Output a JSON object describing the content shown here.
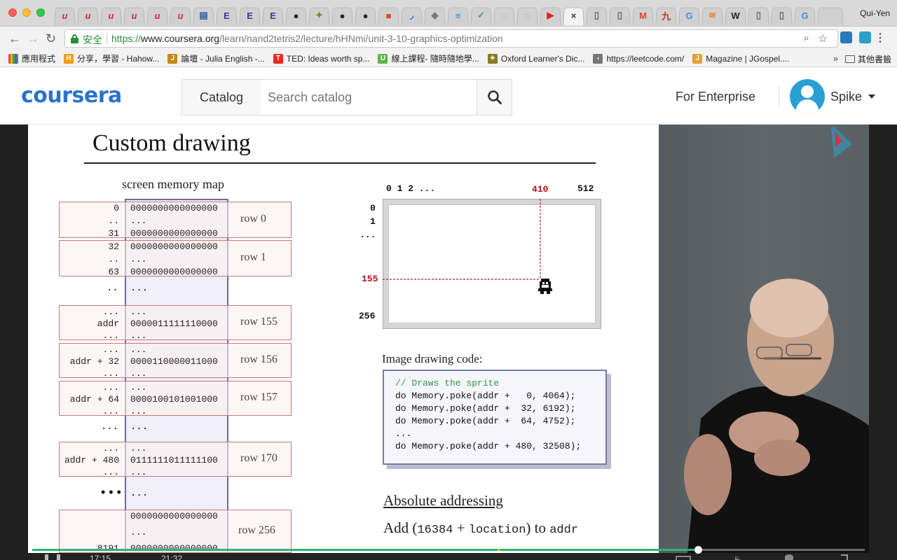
{
  "browser": {
    "profile_name": "Qui-Yen",
    "tabs": [
      {
        "glyph": "u",
        "color": "#d9262f"
      },
      {
        "glyph": "u",
        "color": "#d9262f"
      },
      {
        "glyph": "u",
        "color": "#d9262f"
      },
      {
        "glyph": "u",
        "color": "#d9262f"
      },
      {
        "glyph": "u",
        "color": "#d9262f"
      },
      {
        "glyph": "u",
        "color": "#d9262f"
      },
      {
        "glyph": "▤",
        "color": "#2a5aa8"
      },
      {
        "glyph": "E",
        "color": "#3a3a9a"
      },
      {
        "glyph": "E",
        "color": "#3a3a9a"
      },
      {
        "glyph": "E",
        "color": "#3a3a9a"
      },
      {
        "glyph": "●",
        "color": "#222222"
      },
      {
        "glyph": "✦",
        "color": "#8a7a20"
      },
      {
        "glyph": "●",
        "color": "#222222"
      },
      {
        "glyph": "●",
        "color": "#222222"
      },
      {
        "glyph": "■",
        "color": "#e2462f"
      },
      {
        "glyph": "◞",
        "color": "#2a6fd6"
      },
      {
        "glyph": "◆",
        "color": "#777777"
      },
      {
        "glyph": "≡",
        "color": "#1e88e5"
      },
      {
        "glyph": "✓",
        "color": "#3aa64a"
      },
      {
        "glyph": "◌",
        "color": "#aaaaaa"
      },
      {
        "glyph": "◌",
        "color": "#e67e22"
      },
      {
        "glyph": "▶",
        "color": "#e62117"
      },
      {
        "glyph": "×",
        "color": "#333333",
        "active": true
      },
      {
        "glyph": "▯",
        "color": "#666666"
      },
      {
        "glyph": "▯",
        "color": "#666666"
      },
      {
        "glyph": "M",
        "color": "#d44638"
      },
      {
        "glyph": "九",
        "color": "#c0392b"
      },
      {
        "glyph": "G",
        "color": "#4285f4"
      },
      {
        "glyph": "≋",
        "color": "#f48024"
      },
      {
        "glyph": "W",
        "color": "#222222"
      },
      {
        "glyph": "▯",
        "color": "#666666"
      },
      {
        "glyph": "▯",
        "color": "#666666"
      },
      {
        "glyph": "G",
        "color": "#4285f4"
      }
    ],
    "nav": {
      "back": "←",
      "forward": "→",
      "reload": "↻"
    },
    "secure_label": "安全",
    "url": {
      "scheme": "https://",
      "host": "www.coursera.org",
      "path": "/learn/nand2tetris2/lecture/hHNmi/unit-3-10-graphics-optimization"
    },
    "omnibox_icons": {
      "zoom": "⌕",
      "star": "☆"
    },
    "menu_glyph": "⋮",
    "bookmarks": [
      {
        "label": "應用程式",
        "icon": "apps-icon",
        "color": "#e34b3f"
      },
      {
        "label": "分享，學習 - Hahow...",
        "icon": "hahow-icon",
        "color": "#f39c12",
        "glyph": "H"
      },
      {
        "label": "論壇 - Julia English -...",
        "icon": "julia-icon",
        "color": "#c48a12",
        "glyph": "J"
      },
      {
        "label": "TED: Ideas worth sp...",
        "icon": "ted-icon",
        "color": "#e62b1e",
        "glyph": "T"
      },
      {
        "label": "線上課程- 隨時隨地學...",
        "icon": "hiskio-icon",
        "color": "#5fb548",
        "glyph": "U"
      },
      {
        "label": "Oxford Learner's Dic...",
        "icon": "oxford-icon",
        "color": "#8a7a20",
        "glyph": "✦"
      },
      {
        "label": "https://leetcode.com/",
        "icon": "leetcode-icon",
        "color": "#777777",
        "glyph": "‹"
      },
      {
        "label": "Magazine | JGospel....",
        "icon": "jgospel-icon",
        "color": "#e0a32e",
        "glyph": "J"
      }
    ],
    "bookmarks_more": "»",
    "other_bookmarks": "其他書籤"
  },
  "coursera": {
    "logo": "coursera",
    "catalog_label": "Catalog",
    "search_placeholder": "Search catalog",
    "enterprise_label": "For Enterprise",
    "user_name": "Spike"
  },
  "slide": {
    "title": "Custom drawing",
    "memory_map_label": "screen memory map",
    "memory_rows": [
      {
        "label": "row 0",
        "addr_top": "0",
        "addr_mid": "..",
        "addr_bot": "31",
        "bits_top": "0000000000000000",
        "bits_mid": "...",
        "bits_bot": "0000000000000000"
      },
      {
        "label": "row 1",
        "addr_top": "32",
        "addr_mid": "..",
        "addr_bot": "63",
        "bits_top": "0000000000000000",
        "bits_mid": "...",
        "bits_bot": "0000000000000000"
      },
      {
        "label": "row 155",
        "addr_top": "...",
        "addr_mid": "addr",
        "addr_bot": "...",
        "bits_top": "...",
        "bits_mid": "0000011111110000",
        "bits_bot": "..."
      },
      {
        "label": "row 156",
        "addr_top": "...",
        "addr_mid": "addr + 32",
        "addr_bot": "...",
        "bits_top": "...",
        "bits_mid": "0000110000011000",
        "bits_bot": "..."
      },
      {
        "label": "row 157",
        "addr_top": "...",
        "addr_mid": "addr + 64",
        "addr_bot": "...",
        "bits_top": "...",
        "bits_mid": "0000100101001000",
        "bits_bot": "..."
      },
      {
        "label": "row 170",
        "addr_top": "...",
        "addr_mid": "addr + 480",
        "addr_bot": "...",
        "bits_top": "...",
        "bits_mid": "0111111011111100",
        "bits_bot": "..."
      },
      {
        "label": "row 256",
        "addr_top": "",
        "addr_mid": "",
        "addr_bot": "8191",
        "bits_top": "0000000000000000",
        "bits_mid": "...",
        "bits_bot": "0000000000000000"
      }
    ],
    "gap_dots": {
      "left": "..",
      "right": "..."
    },
    "gap_dots_wide": {
      "left": "...",
      "right": "..."
    },
    "gap_dots_big": {
      "left": "• • •",
      "right": "..."
    },
    "screen": {
      "x_ticks": "0 1 2 ...",
      "x_mark": "410",
      "x_max": "512",
      "y_ticks": [
        "0",
        "1",
        "..."
      ],
      "y_mark": "155",
      "y_max": "256"
    },
    "drawing_code_label": "Image drawing code:",
    "code_lines": [
      "// Draws the sprite",
      "do Memory.poke(addr +   0, 4064);",
      "do Memory.poke(addr +  32, 6192);",
      "do Memory.poke(addr +  64, 4752);",
      "...",
      "do Memory.poke(addr + 480, 32508);"
    ],
    "absolute_addressing": "Absolute addressing",
    "add_line": {
      "prefix": "Add (",
      "num": "16384",
      "plus": " + ",
      "loc": "location",
      "suffix": ") to ",
      "addr": "addr"
    }
  },
  "player": {
    "progress": 0.8,
    "time_current": "17:15",
    "time_total": "21:32"
  },
  "colors": {
    "coursera_blue": "#2a73cc",
    "secure_green": "#2e8b3a",
    "progress_green": "#2bb673",
    "slide_red": "#b3121c"
  }
}
